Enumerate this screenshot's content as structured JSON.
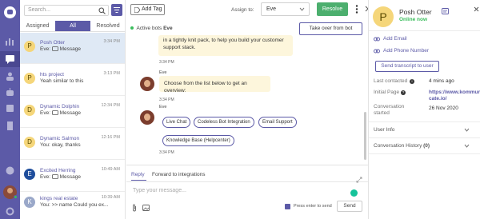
{
  "colors": {
    "brand": "#5c5aa7",
    "resolve": "#4caf6e",
    "online": "#3bbd5c",
    "bubble": "#fdf6dc",
    "active_conversation": "#dfe9f5"
  },
  "rail": {
    "icons": [
      "logo-icon",
      "chart-icon",
      "chat-icon",
      "users-icon",
      "bot-icon",
      "team-icon",
      "knowledge-icon",
      "help-icon",
      "settings-icon"
    ]
  },
  "search": {
    "placeholder": "Search..."
  },
  "list_tabs": [
    {
      "label": "Assigned"
    },
    {
      "label": "All"
    },
    {
      "label": "Resolved"
    }
  ],
  "conversations": [
    {
      "initial": "P",
      "name": "Posh Otter",
      "snippet_prefix": "Eve:",
      "snippet": "Message",
      "time": "3:34 PM",
      "avatar_color": "#f5d67a"
    },
    {
      "initial": "P",
      "name": "hts project",
      "snippet_prefix": "",
      "snippet": "Yeah similar to this",
      "time": "3:13 PM",
      "avatar_color": "#f5d67a"
    },
    {
      "initial": "D",
      "name": "Dynamic Dolphin",
      "snippet_prefix": "Eve:",
      "snippet": "Message",
      "time": "12:34 PM",
      "avatar_color": "#f5d67a"
    },
    {
      "initial": "D",
      "name": "Dynamic Salmon",
      "snippet_prefix": "",
      "snippet": "You: okay, thanks",
      "time": "12:16 PM",
      "avatar_color": "#f5d67a"
    },
    {
      "initial": "E",
      "name": "Excited Herring",
      "snippet_prefix": "Eve:",
      "snippet": "Message",
      "time": "10:49 AM",
      "avatar_color": "#1f4e9c"
    },
    {
      "initial": "K",
      "name": "kings real estate",
      "snippet_prefix": "",
      "snippet": "You: >> name Could you ex...",
      "time": "10:39 AM",
      "avatar_color": "#9aa8c9"
    }
  ],
  "chat": {
    "add_tag": "Add Tag",
    "assign_label": "Assign to:",
    "assignee": "Eve",
    "resolve": "Resolve",
    "active_bots_label": "Active bots",
    "active_bot": "Eve",
    "takeover": "Take over from bot",
    "messages": {
      "m1_text": "in a tightly knit pack, to help you build your customer support stack.",
      "m1_time": "3:34 PM",
      "m2_sender": "Eve",
      "m2_text": "Choose from the list below to get an overview:",
      "m2_time": "3:34 PM",
      "m3_sender": "Eve",
      "m3_time": "3:34 PM"
    },
    "chips": [
      "Live Chat",
      "Codeless Bot Integration",
      "Email Support",
      "Knowledge Base (Helpcenter)"
    ],
    "composer": {
      "tab_reply": "Reply",
      "tab_forward": "Forward to integrations",
      "placeholder": "Type your message...",
      "enter_label": "Press enter to send",
      "enter_checked": true,
      "send": "Send"
    }
  },
  "profile": {
    "initial": "P",
    "name": "Posh Otter",
    "status": "Online now",
    "add_email": "Add Email",
    "add_phone": "Add Phone Number",
    "transcript": "Send transcript to user",
    "last_contacted_label": "Last contacted",
    "last_contacted": "4 mins ago",
    "initial_page_label": "Initial Page",
    "initial_page_line1": "https://www.kommuni",
    "initial_page_line2": "cate.io/",
    "started_label_1": "Conversation",
    "started_label_2": "started",
    "started": "26 Nov 2020",
    "user_info": "User Info",
    "history": "Conversation History",
    "history_count": "(0)"
  }
}
